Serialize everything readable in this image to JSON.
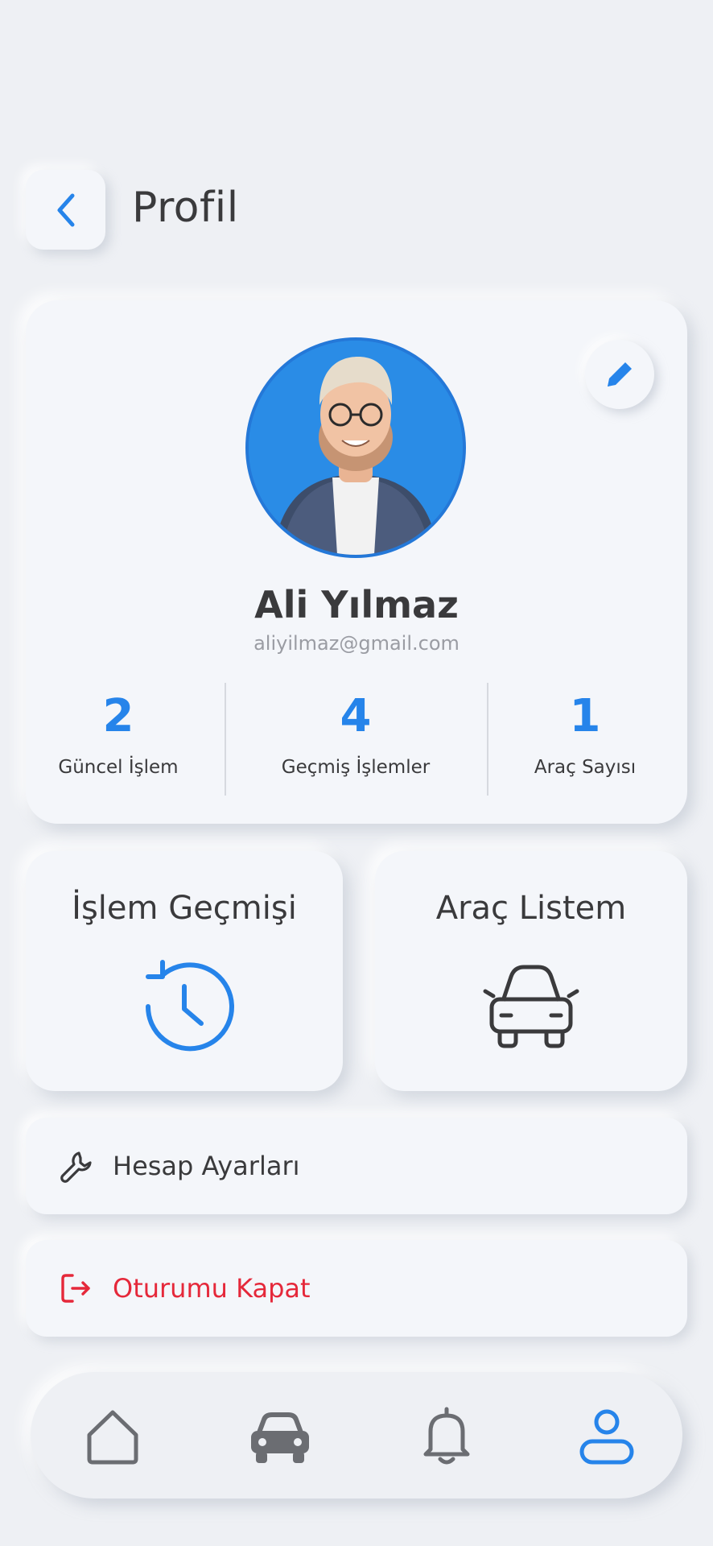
{
  "header": {
    "title": "Profil"
  },
  "profile": {
    "name": "Ali Yılmaz",
    "email": "aliyilmaz@gmail.com",
    "stats": [
      {
        "value": "2",
        "label": "Güncel İşlem"
      },
      {
        "value": "4",
        "label": "Geçmiş İşlemler"
      },
      {
        "value": "1",
        "label": "Araç Sayısı"
      }
    ]
  },
  "actions": {
    "history": {
      "title": "İşlem Geçmişi",
      "icon": "history-icon"
    },
    "vehicles": {
      "title": "Araç Listem",
      "icon": "car-icon"
    }
  },
  "menu": {
    "settings": {
      "label": "Hesap Ayarları",
      "icon": "wrench-icon"
    },
    "logout": {
      "label": "Oturumu Kapat",
      "icon": "logout-icon"
    }
  },
  "nav": {
    "items": [
      "home-icon",
      "car-icon",
      "bell-icon",
      "user-icon"
    ],
    "active": "user-icon"
  },
  "colors": {
    "accent": "#2684ea",
    "danger": "#e5283a",
    "text": "#3a3a3c",
    "muted": "#9a9ca3",
    "background": "#eef0f4"
  }
}
